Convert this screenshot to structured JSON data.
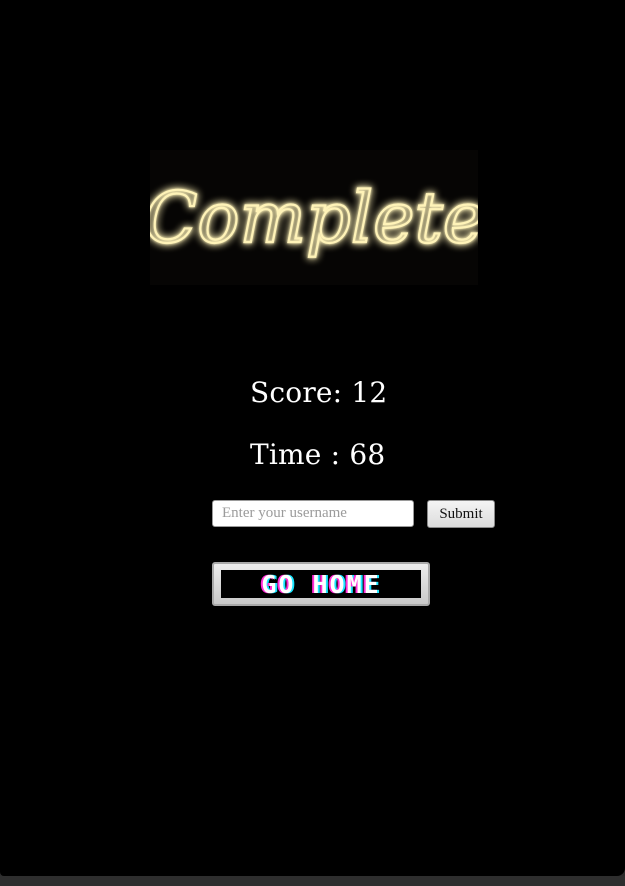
{
  "banner": {
    "text": "Complete",
    "glow_color": "#ffd54a",
    "stroke_color": "#fff6c4"
  },
  "results": {
    "score_label": "Score: 12",
    "time_label": "Time : 68"
  },
  "form": {
    "username_placeholder": "Enter your username",
    "username_value": "",
    "submit_label": "Submit"
  },
  "navigation": {
    "go_home_label": "GO HOME",
    "go_home_shadow_colors": [
      "#ff2bd6",
      "#18e6ff"
    ]
  },
  "colors": {
    "background": "#000000",
    "text": "#ffffff"
  }
}
